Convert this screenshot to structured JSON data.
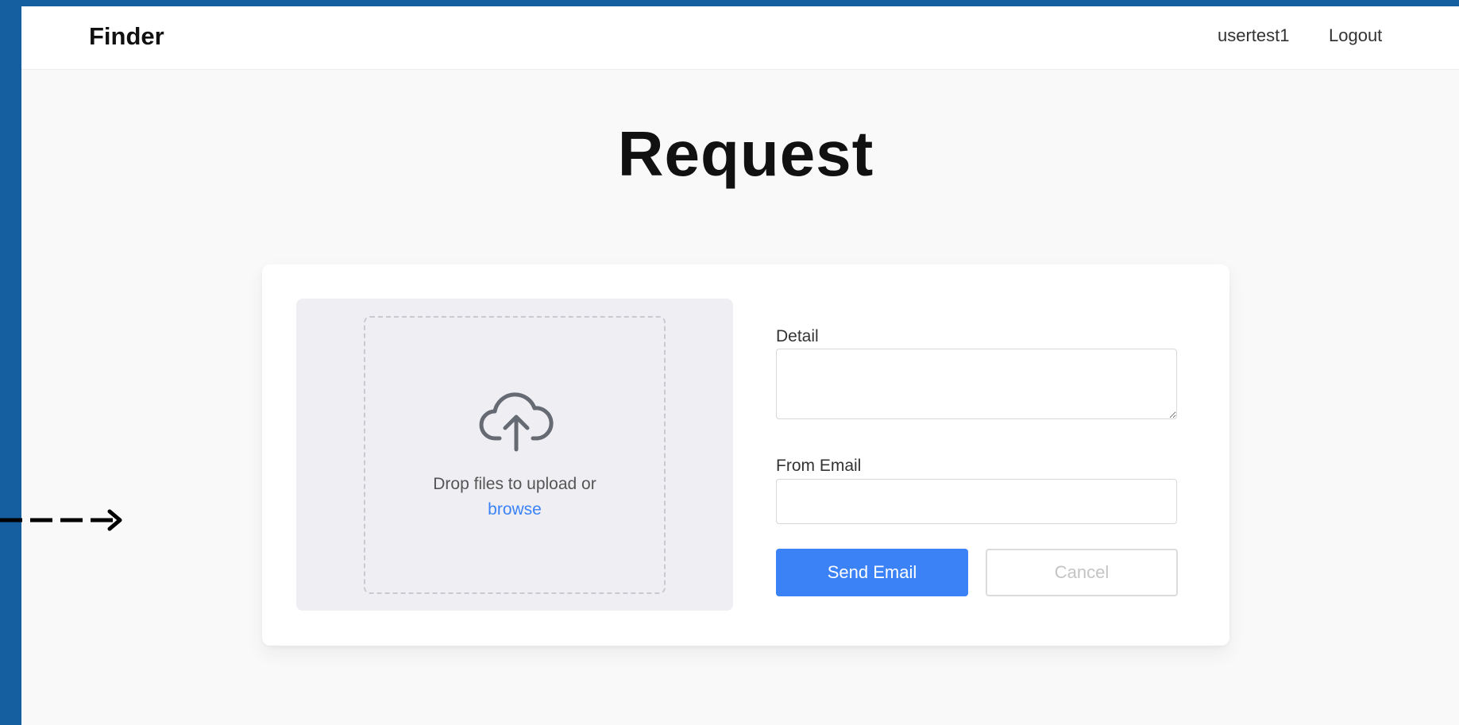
{
  "navbar": {
    "brand": "Finder",
    "username": "usertest1",
    "logout_label": "Logout"
  },
  "page": {
    "title": "Request"
  },
  "upload": {
    "icon": "cloud-upload-icon",
    "drop_text": "Drop files to upload or",
    "browse_label": "browse"
  },
  "form": {
    "detail_label": "Detail",
    "detail_value": "",
    "email_label": "From Email",
    "email_value": "",
    "send_label": "Send Email",
    "cancel_label": "Cancel"
  },
  "colors": {
    "outer_background": "#155fa0",
    "primary": "#3b82f6",
    "page_background": "#f9f9f9"
  }
}
